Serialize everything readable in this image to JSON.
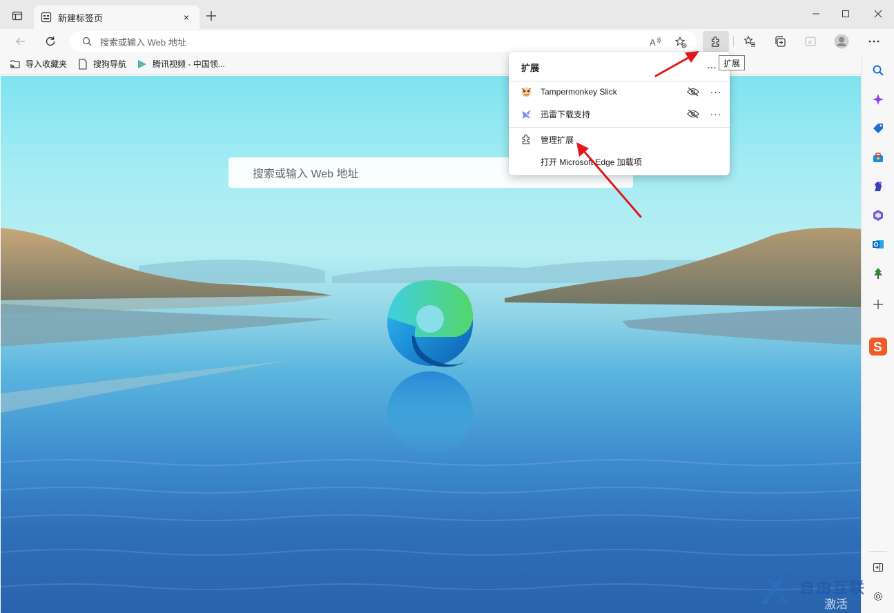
{
  "tab": {
    "title": "新建标签页",
    "close": "×"
  },
  "address_bar": {
    "placeholder": "搜索或输入 Web 地址"
  },
  "favorites": [
    {
      "label": "导入收藏夹",
      "icon": "import-favorites-icon"
    },
    {
      "label": "搜狗导航",
      "icon": "page-icon"
    },
    {
      "label": "腾讯视频 - 中国领...",
      "icon": "tencent-video-icon"
    }
  ],
  "page": {
    "search_placeholder": "搜索或输入 Web 地址"
  },
  "extensions_popup": {
    "title": "扩展",
    "more": "...",
    "items": [
      {
        "name": "Tampermonkey Slick",
        "icon": "tampermonkey-icon",
        "more": "···"
      },
      {
        "name": "迅雷下载支持",
        "icon": "thunder-download-icon",
        "more": "···"
      }
    ],
    "manage": "管理扩展",
    "open_addons": "打开 Microsoft Edge 加载项"
  },
  "tooltip": {
    "text": "扩展"
  },
  "sidebar": {
    "items": [
      "search-icon",
      "copilot-icon",
      "shopping-icon",
      "tools-icon",
      "games-icon",
      "office-icon",
      "outlook-icon",
      "tree-icon",
      "add-icon",
      "sogou-icon"
    ]
  },
  "watermark": {
    "line1": "自由互联",
    "line2": "激活 Windows"
  },
  "colors": {
    "accent": "#0078d4",
    "arrow": "#e0161b",
    "sogou": "#f05a24"
  }
}
